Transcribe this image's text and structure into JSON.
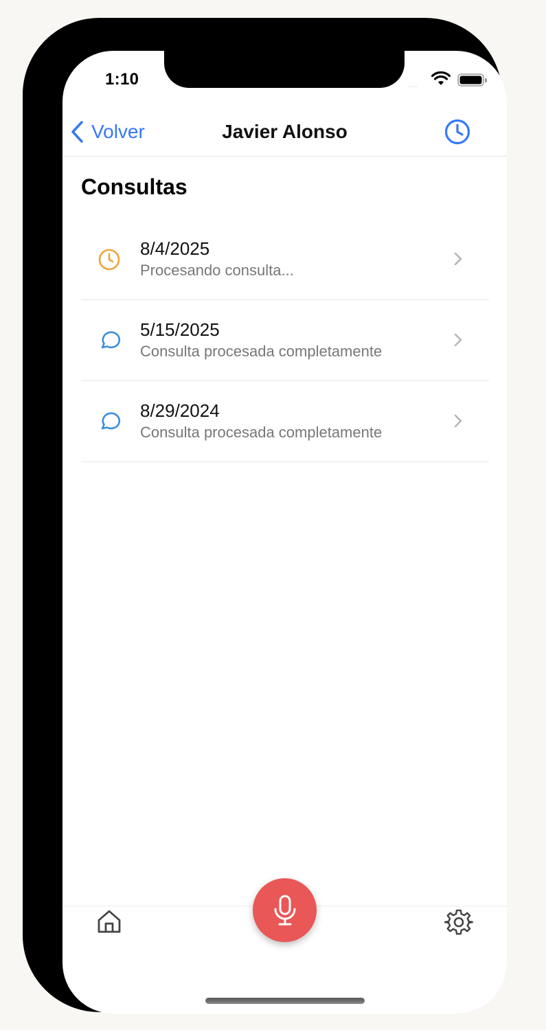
{
  "status_bar": {
    "time": "1:10",
    "signal": "....",
    "icons": [
      "wifi-icon",
      "battery-icon"
    ]
  },
  "navbar": {
    "back_label": "Volver",
    "title": "Javier Alonso",
    "right_icon": "clock-icon"
  },
  "section": {
    "title": "Consultas"
  },
  "consultations": [
    {
      "date": "8/4/2025",
      "status": "Procesando consulta...",
      "icon": "clock-icon",
      "icon_color": "#f0a33a"
    },
    {
      "date": "5/15/2025",
      "status": "Consulta procesada completamente",
      "icon": "chat-bubble-icon",
      "icon_color": "#3b8fdc"
    },
    {
      "date": "8/29/2024",
      "status": "Consulta procesada completamente",
      "icon": "chat-bubble-icon",
      "icon_color": "#3b8fdc"
    }
  ],
  "tabbar": {
    "left_icon": "home-icon",
    "center_icon": "microphone-icon",
    "right_icon": "gear-icon"
  },
  "colors": {
    "accent": "#3478f6",
    "mic_button": "#e95757",
    "processing": "#f0a33a",
    "done": "#3b8fdc"
  }
}
